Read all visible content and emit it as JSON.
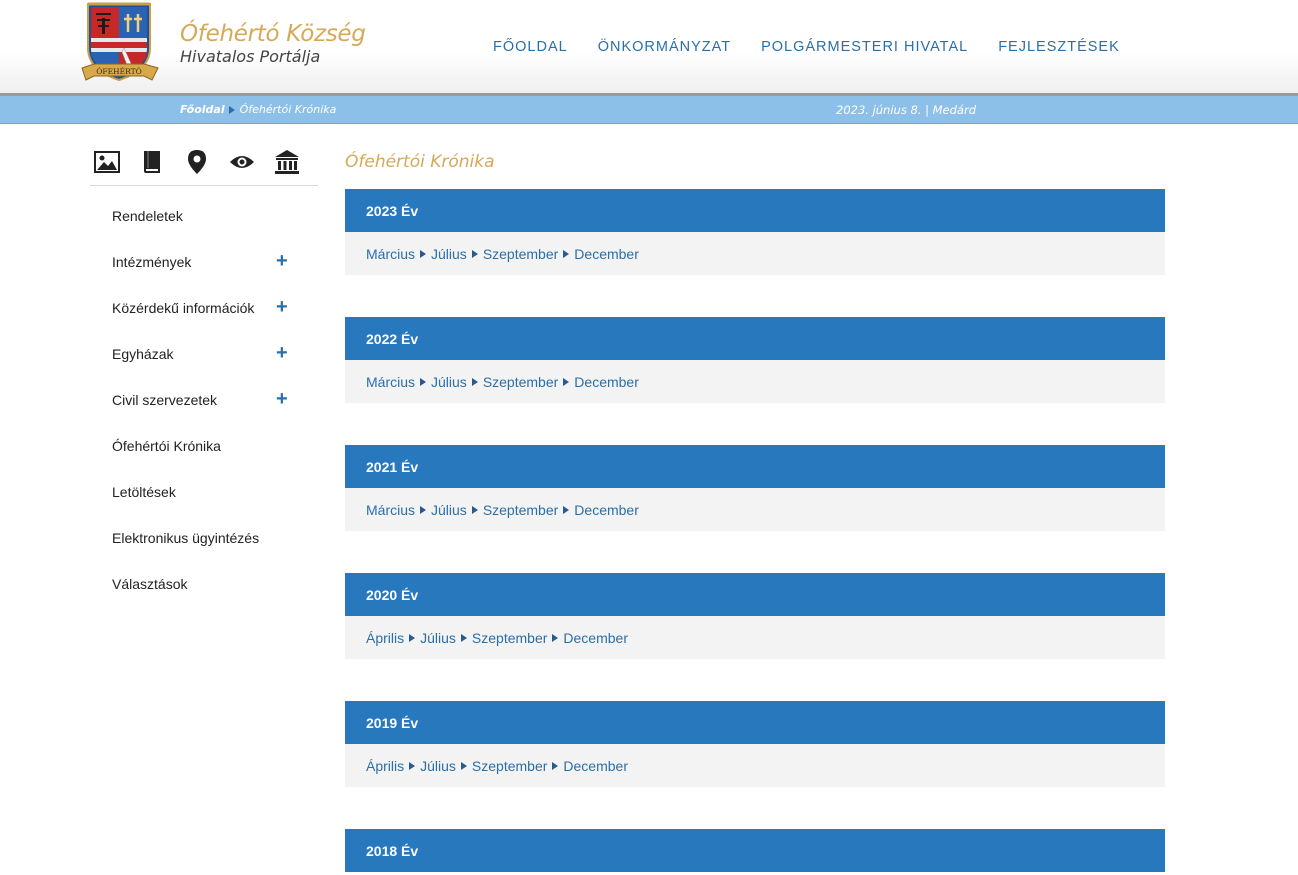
{
  "header": {
    "logo_title": "Ófehértó Község",
    "logo_subtitle": "Hivatalos Portálja",
    "crest_label": "ÓFEHÉRTÓ",
    "nav": [
      {
        "label": "FŐOLDAL"
      },
      {
        "label": "ÖNKORMÁNYZAT"
      },
      {
        "label": "POLGÁRMESTERI HIVATAL"
      },
      {
        "label": "FEJLESZTÉSEK"
      }
    ]
  },
  "breadcrumb": {
    "home": "Főoldal",
    "current": "Ófehértói Krónika",
    "date": "2023. június 8. | Medárd"
  },
  "sidebar": {
    "icons": [
      "image-icon",
      "book-icon",
      "map-pin-icon",
      "eye-icon",
      "institution-icon"
    ],
    "items": [
      {
        "label": "Rendeletek",
        "expandable": false
      },
      {
        "label": "Intézmények",
        "expandable": true
      },
      {
        "label": "Közérdekű információk",
        "expandable": true
      },
      {
        "label": "Egyházak",
        "expandable": true
      },
      {
        "label": "Civil szervezetek",
        "expandable": true
      },
      {
        "label": "Ófehértói Krónika",
        "expandable": false
      },
      {
        "label": "Letöltések",
        "expandable": false
      },
      {
        "label": "Elektronikus ügyintézés",
        "expandable": false
      },
      {
        "label": "Választások",
        "expandable": false
      }
    ],
    "plus_symbol": "+"
  },
  "content": {
    "title": "Ófehértói Krónika",
    "years": [
      {
        "label": "2023 Év",
        "months": [
          "Március",
          "Július",
          "Szeptember",
          "December"
        ]
      },
      {
        "label": "2022 Év",
        "months": [
          "Március",
          "Július",
          "Szeptember",
          "December"
        ]
      },
      {
        "label": "2021 Év",
        "months": [
          "Március",
          "Július",
          "Szeptember",
          "December"
        ]
      },
      {
        "label": "2020 Év",
        "months": [
          "Április",
          "Július",
          "Szeptember",
          "December"
        ]
      },
      {
        "label": "2019 Év",
        "months": [
          "Április",
          "Július",
          "Szeptember",
          "December"
        ]
      },
      {
        "label": "2018 Év",
        "months": []
      }
    ]
  },
  "colors": {
    "accent_blue": "#2778bd",
    "gold": "#d6a85a",
    "crumb_bar": "#8dc0e8"
  }
}
